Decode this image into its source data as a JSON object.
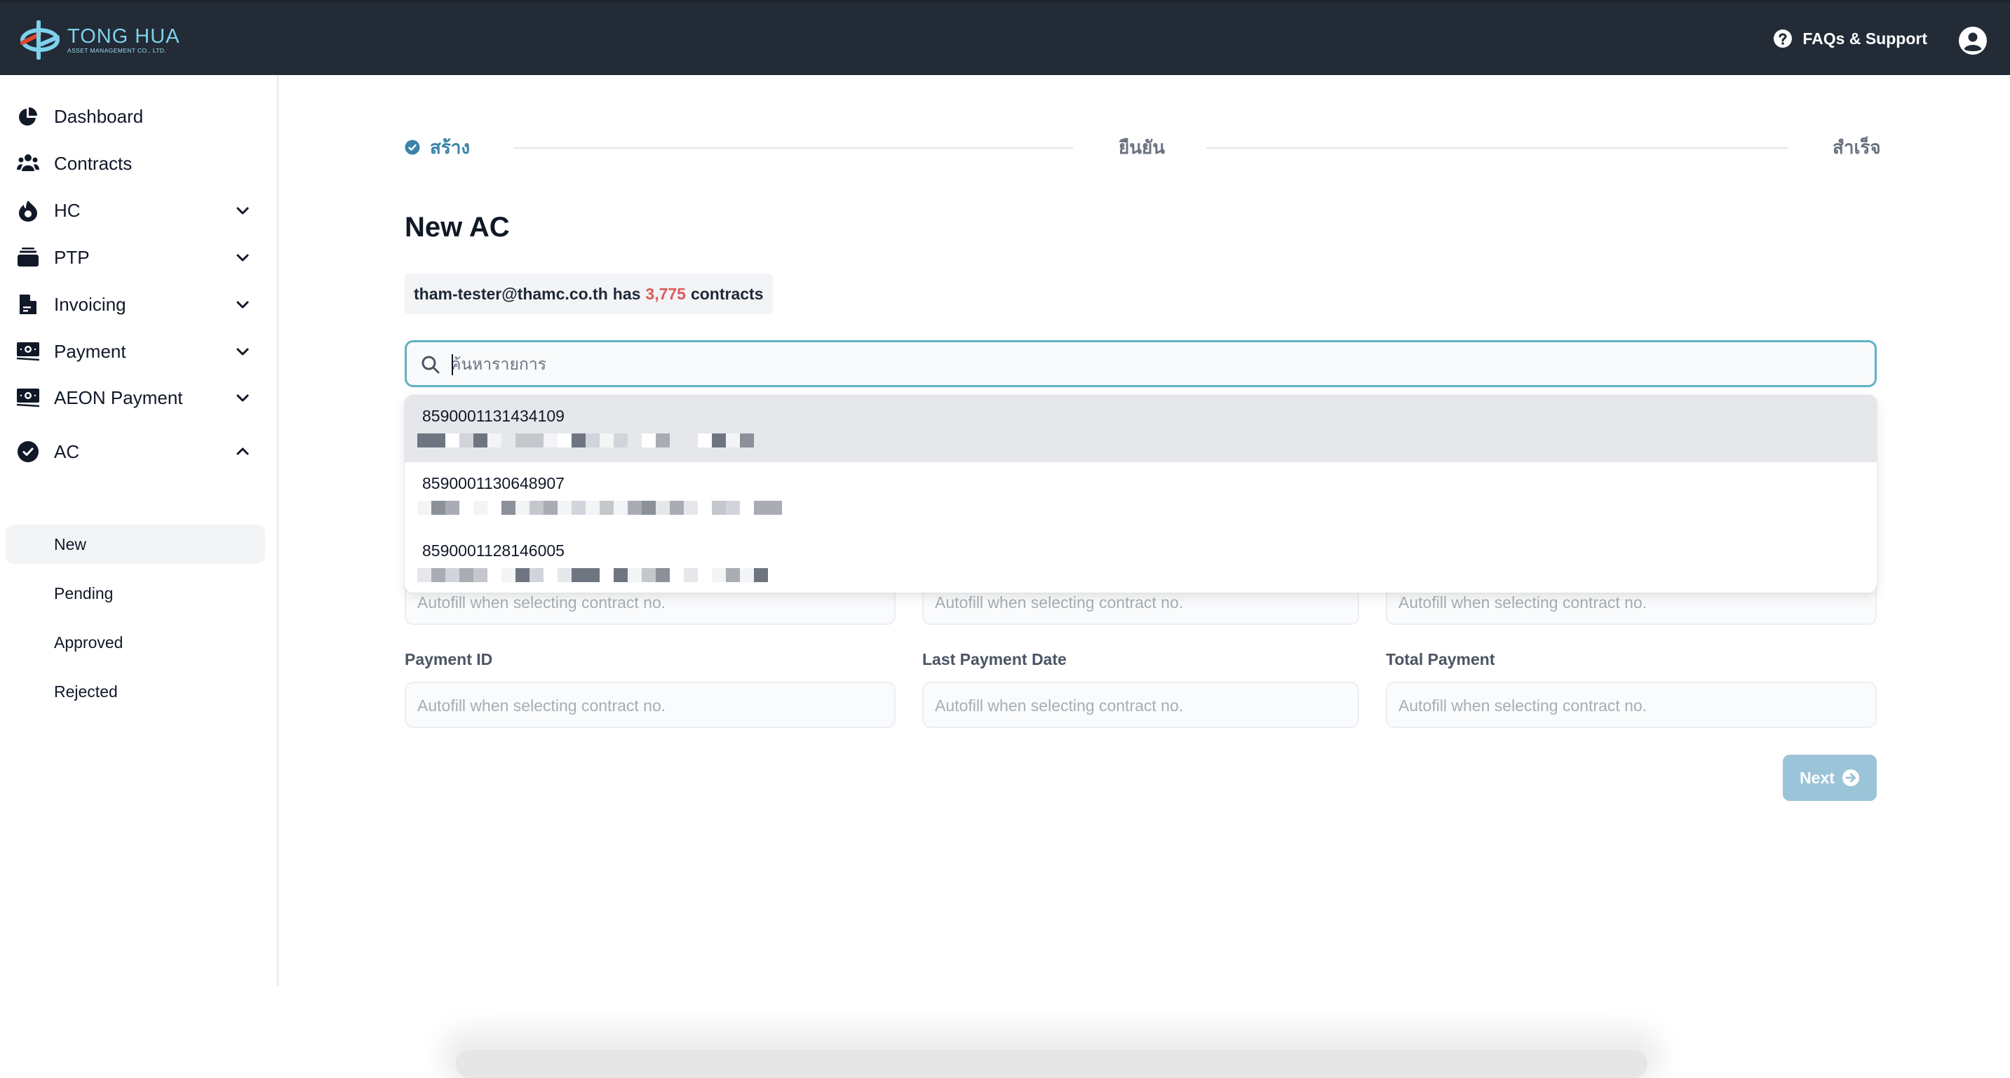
{
  "header": {
    "logo_title": "TONG HUA",
    "logo_subtitle": "ASSET MANAGEMENT CO., LTD.",
    "support_label": "FAQs & Support",
    "support_icon": "question-circle-icon",
    "profile_icon": "user-circle-icon"
  },
  "sidebar": {
    "items": [
      {
        "label": "Dashboard",
        "icon": "pie-chart-icon",
        "expandable": false
      },
      {
        "label": "Contracts",
        "icon": "users-group-icon",
        "expandable": false
      },
      {
        "label": "HC",
        "icon": "fire-icon",
        "expandable": true,
        "expanded": false
      },
      {
        "label": "PTP",
        "icon": "stack-icon",
        "expandable": true,
        "expanded": false
      },
      {
        "label": "Invoicing",
        "icon": "document-icon",
        "expandable": true,
        "expanded": false
      },
      {
        "label": "Payment",
        "icon": "banknote-icon",
        "expandable": true,
        "expanded": false
      },
      {
        "label": "AEON Payment",
        "icon": "banknote-icon",
        "expandable": true,
        "expanded": false
      },
      {
        "label": "AC",
        "icon": "check-circle-icon",
        "expandable": true,
        "expanded": true
      }
    ],
    "ac_subitems": [
      {
        "label": "New",
        "active": true
      },
      {
        "label": "Pending",
        "active": false
      },
      {
        "label": "Approved",
        "active": false
      },
      {
        "label": "Rejected",
        "active": false
      }
    ]
  },
  "stepper": {
    "steps": [
      {
        "label": "สร้าง",
        "status": "done"
      },
      {
        "label": "ยืนยัน",
        "status": "todo"
      },
      {
        "label": "สำเร็จ",
        "status": "todo"
      }
    ]
  },
  "page": {
    "title": "New AC",
    "info": {
      "user": "tham-tester@thamc.co.th",
      "has": "has",
      "count": "3,775",
      "suffix": "contracts"
    }
  },
  "search": {
    "placeholder": "ค้นหารายการ",
    "value": ""
  },
  "dropdown": {
    "items": [
      {
        "contract_no": "8590001131434109",
        "detail": "[redacted]",
        "highlighted": true
      },
      {
        "contract_no": "8590001130648907",
        "detail": "[redacted]",
        "highlighted": false
      },
      {
        "contract_no": "8590001128146005",
        "detail": "[redacted]",
        "highlighted": false
      }
    ]
  },
  "form": {
    "fields_row1": [
      {
        "label": "",
        "placeholder": "Autofill when selecting contract no."
      },
      {
        "label": "",
        "placeholder": "Autofill when selecting contract no."
      },
      {
        "label": "",
        "placeholder": "Autofill when selecting contract no."
      }
    ],
    "fields_row2": [
      {
        "label": "Payment ID",
        "placeholder": "Autofill when selecting contract no."
      },
      {
        "label": "Last Payment Date",
        "placeholder": "Autofill when selecting contract no."
      },
      {
        "label": "Total Payment",
        "placeholder": "Autofill when selecting contract no."
      }
    ],
    "next_label": "Next",
    "next_enabled": false
  },
  "colors": {
    "header_bg": "#222b36",
    "accent": "#3b82a8",
    "search_border": "#5fb1c4",
    "count_highlight": "#dc5a5a",
    "next_button_disabled": "#9cc4d9"
  }
}
